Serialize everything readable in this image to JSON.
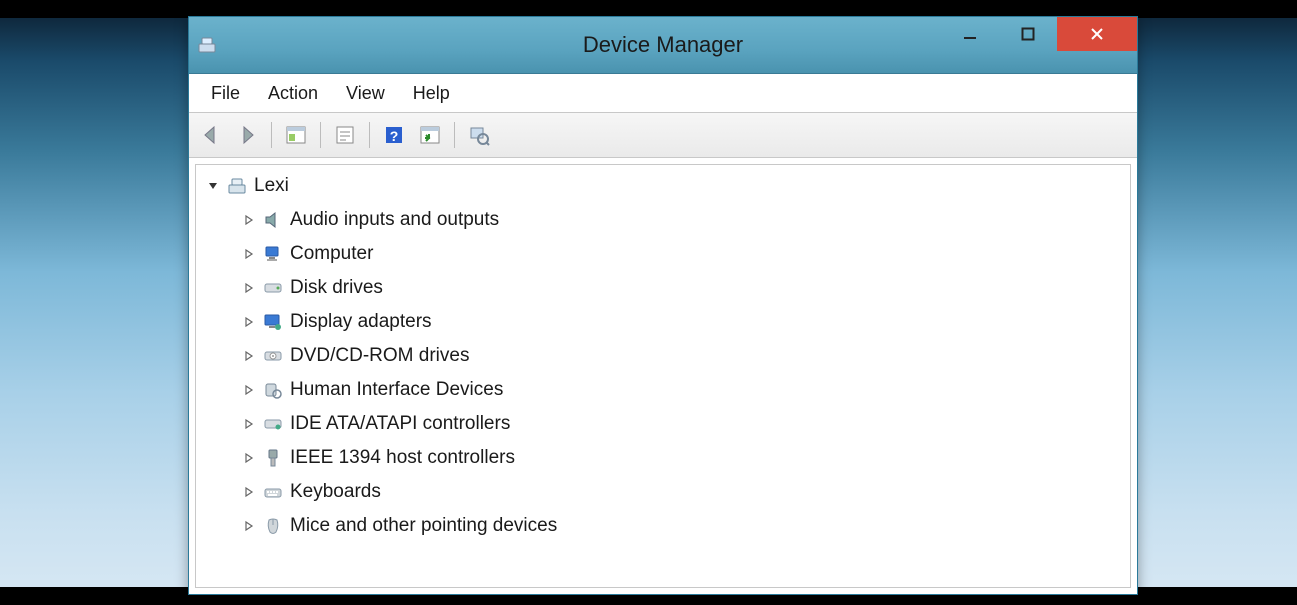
{
  "window": {
    "title": "Device Manager"
  },
  "menubar": {
    "items": [
      "File",
      "Action",
      "View",
      "Help"
    ]
  },
  "tree": {
    "root": {
      "label": "Lexi",
      "expanded": true,
      "icon": "computer-root-icon"
    },
    "children": [
      {
        "label": "Audio inputs and outputs",
        "icon": "speaker-icon"
      },
      {
        "label": "Computer",
        "icon": "computer-icon"
      },
      {
        "label": "Disk drives",
        "icon": "disk-icon"
      },
      {
        "label": "Display adapters",
        "icon": "display-icon"
      },
      {
        "label": "DVD/CD-ROM drives",
        "icon": "optical-icon"
      },
      {
        "label": "Human Interface Devices",
        "icon": "hid-icon"
      },
      {
        "label": "IDE ATA/ATAPI controllers",
        "icon": "ide-icon"
      },
      {
        "label": "IEEE 1394 host controllers",
        "icon": "firewire-icon"
      },
      {
        "label": "Keyboards",
        "icon": "keyboard-icon"
      },
      {
        "label": "Mice and other pointing devices",
        "icon": "mouse-icon"
      }
    ]
  }
}
